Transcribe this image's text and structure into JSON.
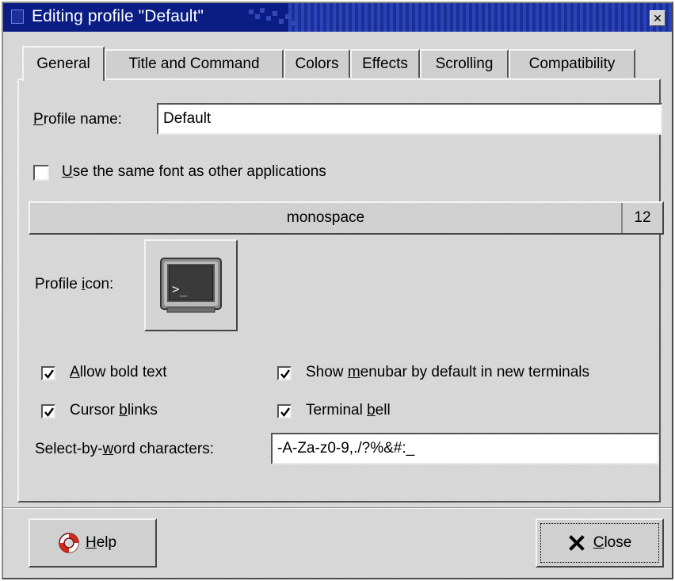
{
  "window": {
    "title": "Editing profile \"Default\"",
    "title_color": "#ffffff",
    "titlebar_color": "#0b1d84"
  },
  "tabs": [
    {
      "label": "General",
      "active": true
    },
    {
      "label": "Title and Command",
      "active": false
    },
    {
      "label": "Colors",
      "active": false
    },
    {
      "label": "Effects",
      "active": false
    },
    {
      "label": "Scrolling",
      "active": false
    },
    {
      "label": "Compatibility",
      "active": false
    }
  ],
  "general": {
    "profile_name_label_mnemonic": "P",
    "profile_name_label_rest": "rofile name:",
    "profile_name_value": "Default",
    "same_font_checked": false,
    "same_font_label_mnemonic": "U",
    "same_font_label_rest": "se the same font as other applications",
    "font_name": "monospace",
    "font_size": "12",
    "profile_icon_label_pre": "Profile ",
    "profile_icon_label_mnemonic": "i",
    "profile_icon_label_rest": "con:",
    "profile_icon_name": "terminal-icon",
    "allow_bold_checked": true,
    "allow_bold_mnemonic": "A",
    "allow_bold_rest": "llow bold text",
    "show_menubar_checked": true,
    "show_menubar_pre": "Show ",
    "show_menubar_mnemonic": "m",
    "show_menubar_rest": "enubar by default in new terminals",
    "cursor_blinks_checked": true,
    "cursor_blinks_pre": "Cursor ",
    "cursor_blinks_mnemonic": "b",
    "cursor_blinks_rest": "links",
    "terminal_bell_checked": true,
    "terminal_bell_pre": "Terminal ",
    "terminal_bell_mnemonic": "b",
    "terminal_bell_rest": "ell",
    "select_word_pre": "Select-by-",
    "select_word_mnemonic": "w",
    "select_word_rest": "ord characters:",
    "select_word_value": "-A-Za-z0-9,./?%&#:_"
  },
  "footer": {
    "help_mnemonic": "H",
    "help_rest": "elp",
    "help_icon": "lifebuoy-icon",
    "close_mnemonic": "C",
    "close_rest": "lose",
    "close_icon": "x-icon"
  }
}
